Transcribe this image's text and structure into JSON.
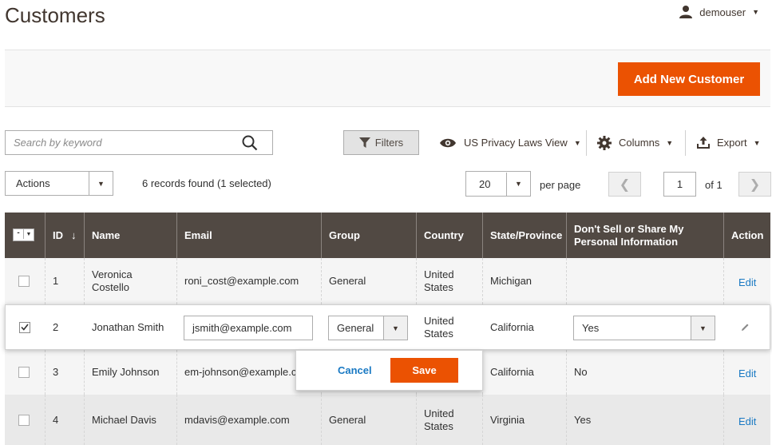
{
  "page": {
    "title": "Customers"
  },
  "user": {
    "name": "demouser",
    "icon": "user-icon"
  },
  "toolbar": {
    "add_button": "Add New Customer",
    "search_placeholder": "Search by keyword",
    "filters_label": "Filters",
    "view_label": "US Privacy Laws View",
    "columns_label": "Columns",
    "export_label": "Export",
    "actions_label": "Actions",
    "records_found": "6 records found (1 selected)",
    "per_page_value": "20",
    "per_page_label": "per page",
    "current_page": "1",
    "of_pages": "of 1"
  },
  "colors": {
    "accent": "#eb5202",
    "header_bg": "#514943",
    "link": "#1979c3"
  },
  "table": {
    "headers": {
      "id": "ID",
      "name": "Name",
      "email": "Email",
      "group": "Group",
      "country": "Country",
      "state": "State/Province",
      "dont_sell": "Don't Sell or Share My Personal Information",
      "action": "Action"
    },
    "rows": [
      {
        "id": "1",
        "name": "Veronica Costello",
        "email": "roni_cost@example.com",
        "group": "General",
        "country": "United States",
        "state": "Michigan",
        "dont_sell": "",
        "action": "Edit",
        "selected": false
      },
      {
        "id": "2",
        "name": "Jonathan Smith",
        "email": "jsmith@example.com",
        "group": "General",
        "country": "United States",
        "state": "California",
        "dont_sell": "Yes",
        "action": "",
        "selected": true
      },
      {
        "id": "3",
        "name": "Emily Johnson",
        "email": "em-johnson@example.co",
        "group": "",
        "country": "",
        "state": "California",
        "dont_sell": "No",
        "action": "Edit",
        "selected": false
      },
      {
        "id": "4",
        "name": "Michael Davis",
        "email": "mdavis@example.com",
        "group": "General",
        "country": "United States",
        "state": "Virginia",
        "dont_sell": "Yes",
        "action": "Edit",
        "selected": false
      }
    ]
  },
  "inline_edit": {
    "cancel_label": "Cancel",
    "save_label": "Save"
  }
}
